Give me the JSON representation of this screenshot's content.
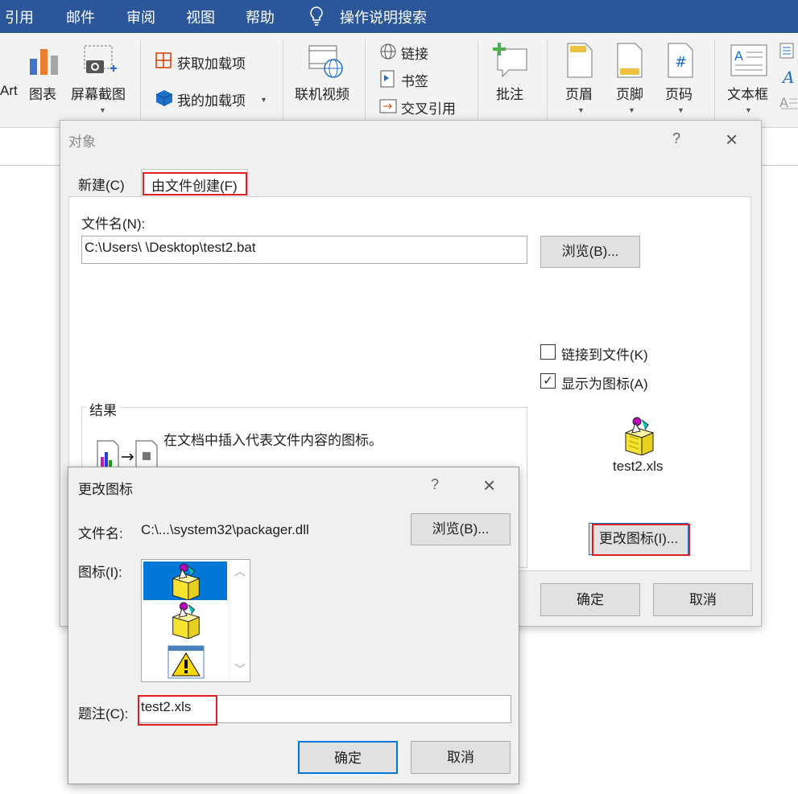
{
  "ribbon_tabs": [
    "引用",
    "邮件",
    "审阅",
    "视图",
    "帮助",
    "操作说明搜索"
  ],
  "ribbon": {
    "art_partial": "Art",
    "group_partial": "图",
    "chart": "图表",
    "screenshot": "屏幕截图",
    "get_addins": "获取加载项",
    "my_addins": "我的加载项",
    "online_video": "联机视频",
    "link": "链接",
    "bookmark": "书签",
    "cross_reference": "交叉引用",
    "comment": "批注",
    "header": "页眉",
    "footer": "页脚",
    "page_number": "页码",
    "text_box": "文本框"
  },
  "object_dialog": {
    "title": "对象",
    "help": "?",
    "tabs": [
      "新建(C)",
      "由文件创建(F)"
    ],
    "filename_label": "文件名(N):",
    "filename_value": "C:\\Users\\        \\Desktop\\test2.bat",
    "browse": "浏览(B)...",
    "link_to_file": "链接到文件(K)",
    "link_checked": false,
    "display_as_icon": "显示为图标(A)",
    "display_checked": true,
    "result_label": "结果",
    "result_text": "在文档中插入代表文件内容的图标。",
    "icon_caption": "test2.xls",
    "change_icon": "更改图标(I)...",
    "ok": "确定",
    "cancel": "取消"
  },
  "change_icon_dialog": {
    "title": "更改图标",
    "help": "?",
    "filename_label": "文件名:",
    "filename_value": "C:\\...\\system32\\packager.dll",
    "browse": "浏览(B)...",
    "icon_label": "图标(I):",
    "icons": [
      "package-icon",
      "package-icon",
      "warning-icon"
    ],
    "selected_icon_index": 0,
    "caption_label": "题注(C):",
    "caption_value": "test2.xls",
    "ok": "确定",
    "cancel": "取消"
  },
  "colors": {
    "ribbon_blue": "#2b579a",
    "highlight_red": "#e02020",
    "selection_blue": "#0078d7"
  }
}
